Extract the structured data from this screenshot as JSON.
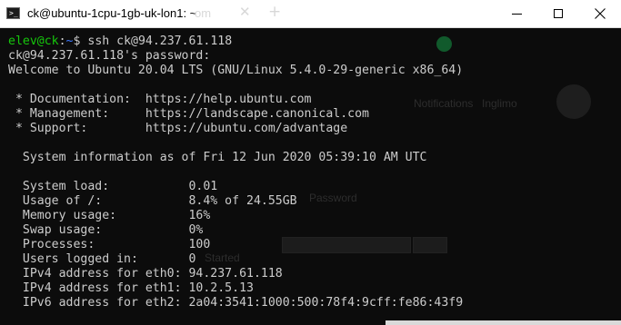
{
  "window": {
    "title": "ck@ubuntu-1cpu-1gb-uk-lon1: ~",
    "icon": "terminal-icon",
    "controls": [
      "minimize-icon",
      "maximize-icon",
      "close-icon"
    ],
    "background_tab_label": "om",
    "background_tab_close": "✕",
    "new_tab_glyph": "+"
  },
  "colors": {
    "terminal_bg": "#0c0c0c",
    "terminal_fg": "#cccccc",
    "prompt_user": "#16c60c",
    "prompt_path": "#3b78ff",
    "titlebar_bg": "#ffffff"
  },
  "terminal": {
    "prompt": {
      "user_host": "elev@ck",
      "separator": ":",
      "path": "~",
      "symbol": "$ ",
      "command": "ssh ck@94.237.61.118"
    },
    "lines": [
      "ck@94.237.61.118's password:",
      "Welcome to Ubuntu 20.04 LTS (GNU/Linux 5.4.0-29-generic x86_64)",
      "",
      " * Documentation:  https://help.ubuntu.com",
      " * Management:     https://landscape.canonical.com",
      " * Support:        https://ubuntu.com/advantage",
      "",
      "  System information as of Fri 12 Jun 2020 05:39:10 AM UTC",
      "",
      "  System load:           0.01",
      "  Usage of /:            8.4% of 24.55GB",
      "  Memory usage:          16%",
      "  Swap usage:            0%",
      "  Processes:             100",
      "  Users logged in:       0",
      "  IPv4 address for eth0: 94.237.61.118",
      "  IPv4 address for eth1: 10.2.5.13",
      "  IPv6 address for eth2: 2a04:3541:1000:500:78f4:9cff:fe86:43f9"
    ]
  },
  "background_ghost": {
    "notifications": "Notifications",
    "menu": "Inglimo",
    "password": "Password",
    "started": "Started"
  }
}
